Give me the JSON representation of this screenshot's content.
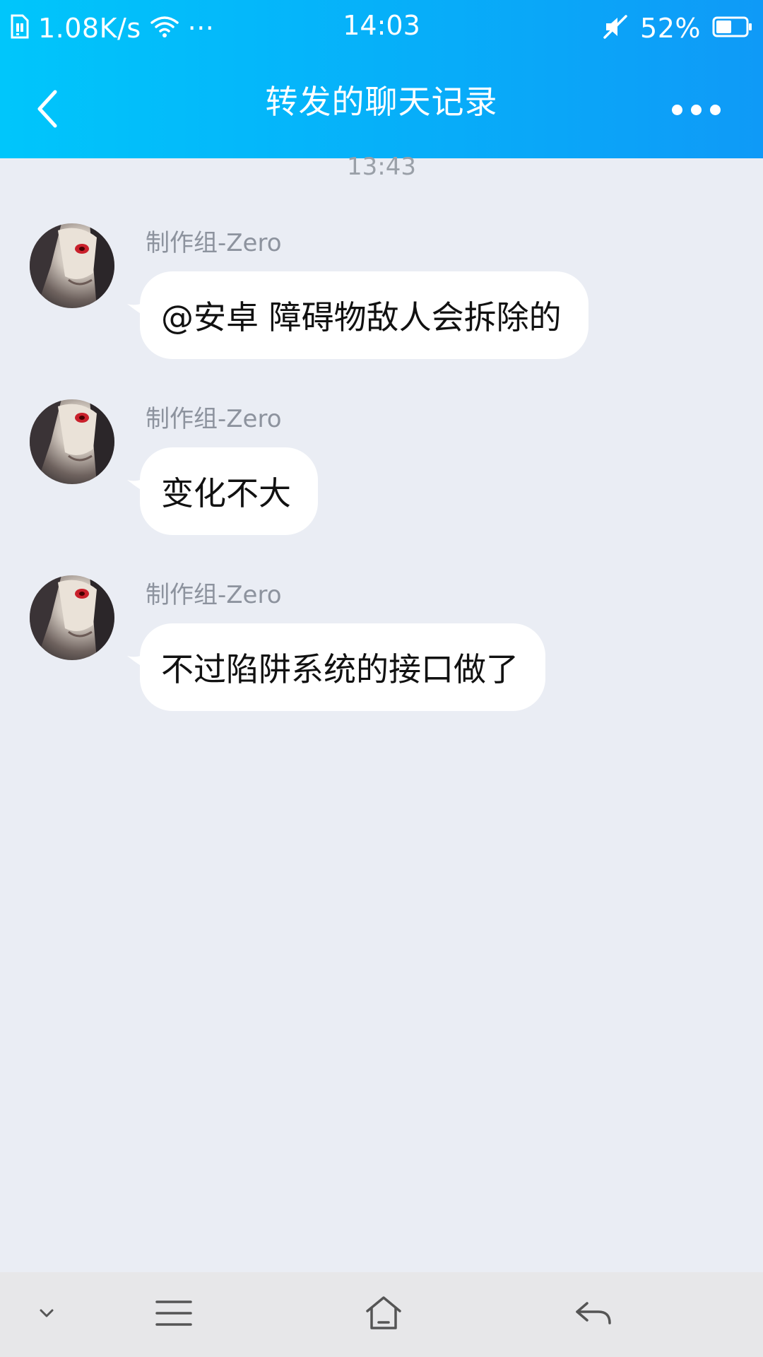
{
  "status_bar": {
    "net_speed": "1.08K/s",
    "overflow": "···",
    "time": "14:03",
    "battery": "52%",
    "battery_level": 0.52,
    "icons": [
      "sim-icon",
      "wifi-icon",
      "mute-icon",
      "battery-icon"
    ]
  },
  "header": {
    "title": "转发的聊天记录",
    "back_icon": "chevron-left-icon",
    "more_icon": "more-dots-icon",
    "accent": "#07AEF9"
  },
  "chat": {
    "time_label": "13:43",
    "messages": [
      {
        "sender": "制作组-Zero",
        "text": "@安卓 障碍物敌人会拆除的"
      },
      {
        "sender": "制作组-Zero",
        "text": "变化不大"
      },
      {
        "sender": "制作组-Zero",
        "text": "不过陷阱系统的接口做了"
      }
    ]
  },
  "nav_bar": {
    "items": [
      "chevron-down-icon",
      "menu-icon",
      "home-icon",
      "back-icon"
    ]
  }
}
